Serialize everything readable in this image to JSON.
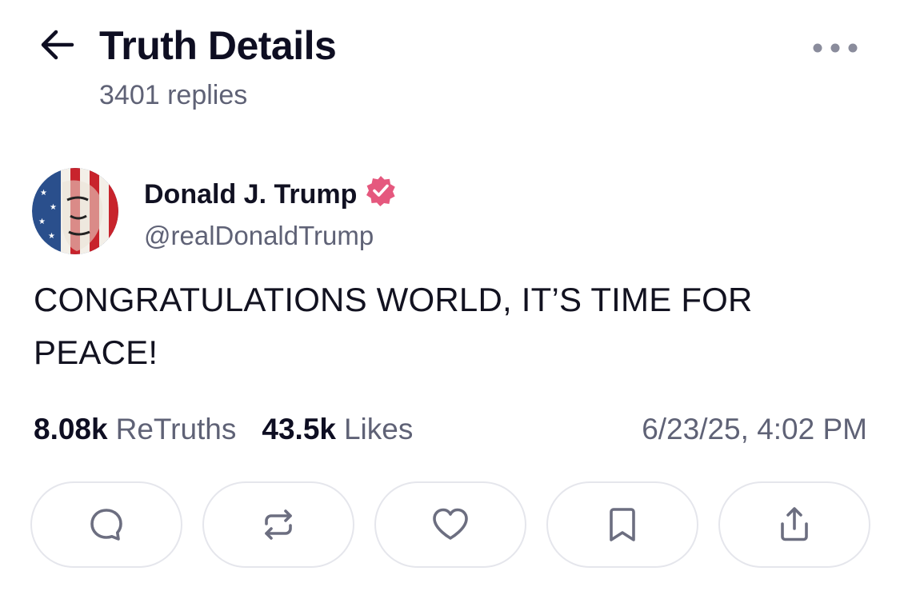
{
  "header": {
    "title": "Truth Details",
    "reply_count": "3401 replies",
    "back_icon": "arrow-left-icon",
    "more_icon": "more-horizontal-icon"
  },
  "post": {
    "author": {
      "name": "Donald J. Trump",
      "handle": "@realDonaldTrump",
      "verified": true,
      "verified_color": "#e5587e"
    },
    "text": "CONGRATULATIONS WORLD, IT’S TIME FOR PEACE!",
    "stats": {
      "retruths_count": "8.08k",
      "retruths_label": "ReTruths",
      "likes_count": "43.5k",
      "likes_label": "Likes",
      "timestamp": "6/23/25, 4:02 PM"
    }
  },
  "actions": [
    {
      "name": "reply",
      "icon": "comment-icon"
    },
    {
      "name": "retruth",
      "icon": "repost-icon"
    },
    {
      "name": "like",
      "icon": "heart-icon"
    },
    {
      "name": "bookmark",
      "icon": "bookmark-icon"
    },
    {
      "name": "share",
      "icon": "share-icon"
    }
  ],
  "colors": {
    "text_primary": "#0e0e22",
    "text_secondary": "#5f6276",
    "border": "#e5e6ec",
    "icon": "#6c6e80"
  }
}
